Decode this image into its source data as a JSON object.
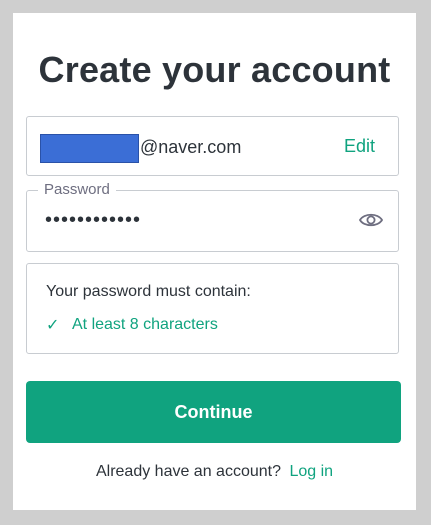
{
  "page": {
    "title": "Create your account"
  },
  "email": {
    "domain": "@naver.com",
    "edit_label": "Edit"
  },
  "password": {
    "label": "Password",
    "masked_value": "••••••••••••",
    "toggle_icon": "eye-icon"
  },
  "requirements": {
    "title": "Your password must contain:",
    "items": [
      {
        "check": "✓",
        "text": "At least 8 characters",
        "met": true
      }
    ]
  },
  "actions": {
    "continue_label": "Continue"
  },
  "footer": {
    "prompt": "Already have an account?",
    "login_label": "Log in"
  },
  "colors": {
    "accent": "#10a37f",
    "text": "#2d333a",
    "redaction": "#3b6ed6"
  }
}
